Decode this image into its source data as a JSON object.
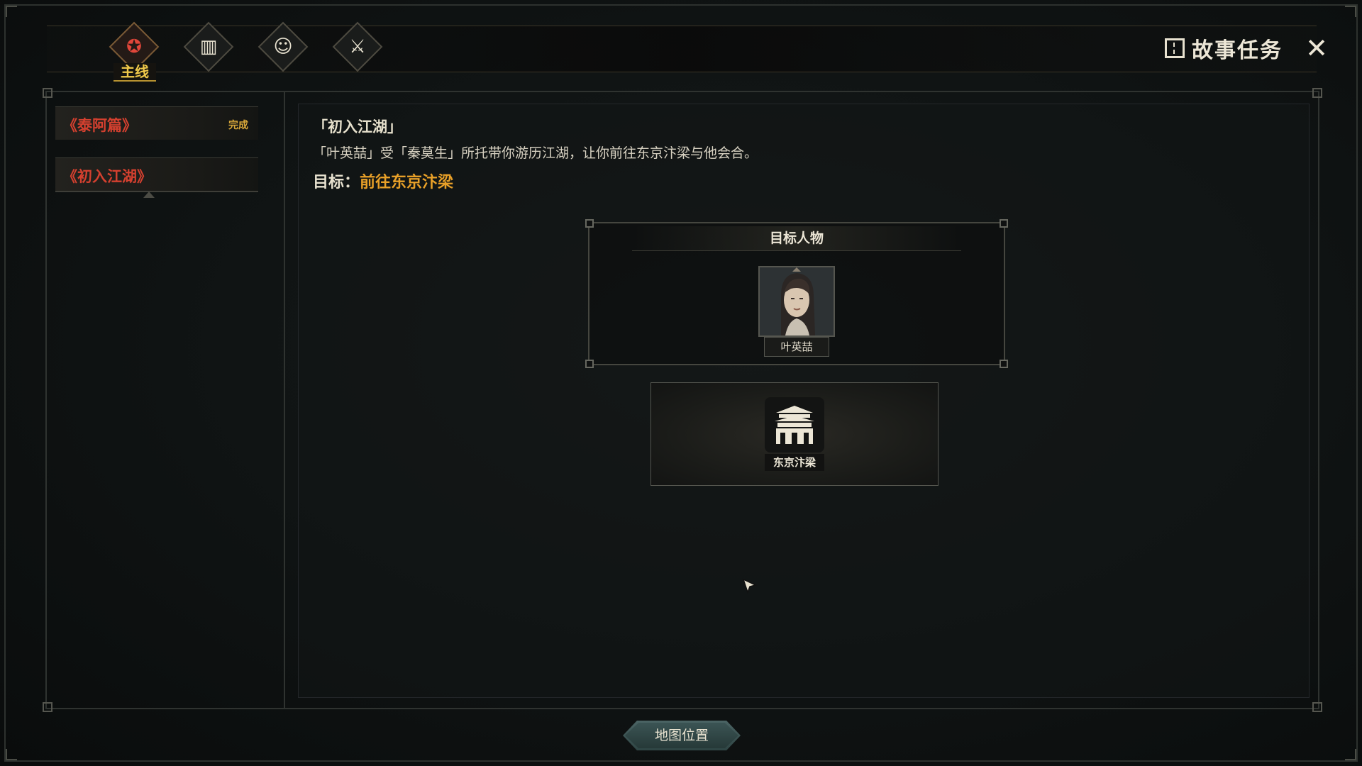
{
  "header": {
    "title": "故事任务",
    "close_icon": "✕",
    "tabs": [
      {
        "icon": "main-quest-icon",
        "glyph": "✪",
        "label": "主线",
        "active": true
      },
      {
        "icon": "book-icon",
        "glyph": "▥",
        "active": false
      },
      {
        "icon": "character-icon",
        "glyph": "☺",
        "active": false
      },
      {
        "icon": "crossed-swords-icon",
        "glyph": "⚔",
        "active": false
      }
    ]
  },
  "sidebar": {
    "quests": [
      {
        "name": "《泰阿篇》",
        "status": "完成"
      },
      {
        "name": "《初入江湖》",
        "status": ""
      }
    ]
  },
  "detail": {
    "title": "「初入江湖」",
    "description": "「叶英喆」受「秦莫生」所托带你游历江湖，让你前往东京汴梁与他会合。",
    "goal_label": "目标：",
    "goal_value": "前往东京汴梁",
    "target_header": "目标人物",
    "target_name": "叶英喆",
    "location_name": "东京汴梁"
  },
  "footer": {
    "map_button": "地图位置"
  },
  "colors": {
    "quest_red": "#d4402f",
    "goal_orange": "#e8a028",
    "status_gold": "#d9a83a",
    "tab_label_yellow": "#f0c94a"
  }
}
